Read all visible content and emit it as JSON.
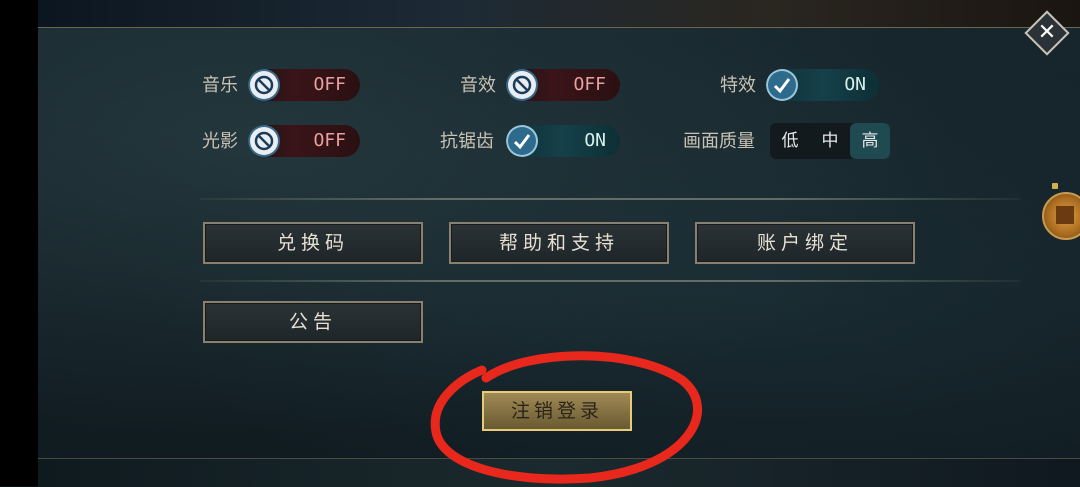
{
  "settings": {
    "music": {
      "label": "音乐",
      "state": "OFF"
    },
    "sound_effects": {
      "label": "音效",
      "state": "OFF"
    },
    "special_effects": {
      "label": "特效",
      "state": "ON"
    },
    "lighting": {
      "label": "光影",
      "state": "OFF"
    },
    "anti_aliasing": {
      "label": "抗锯齿",
      "state": "ON"
    },
    "graphics_quality": {
      "label": "画面质量",
      "options": [
        "低",
        "中",
        "高"
      ],
      "selected": "高"
    }
  },
  "buttons": {
    "redeem_code": "兑换码",
    "help_support": "帮助和支持",
    "account_binding": "账户绑定",
    "announcement": "公告",
    "logout": "注销登录"
  },
  "colors": {
    "toggle_off_text": "#e8a0a0",
    "toggle_on_bg": "#15404a",
    "logout_border": "#e6cc7a",
    "annotation_circle": "#e8281c"
  },
  "icons": {
    "close": "close-x-icon",
    "off_toggle": "no-entry-icon",
    "on_toggle": "checkmark-icon"
  }
}
